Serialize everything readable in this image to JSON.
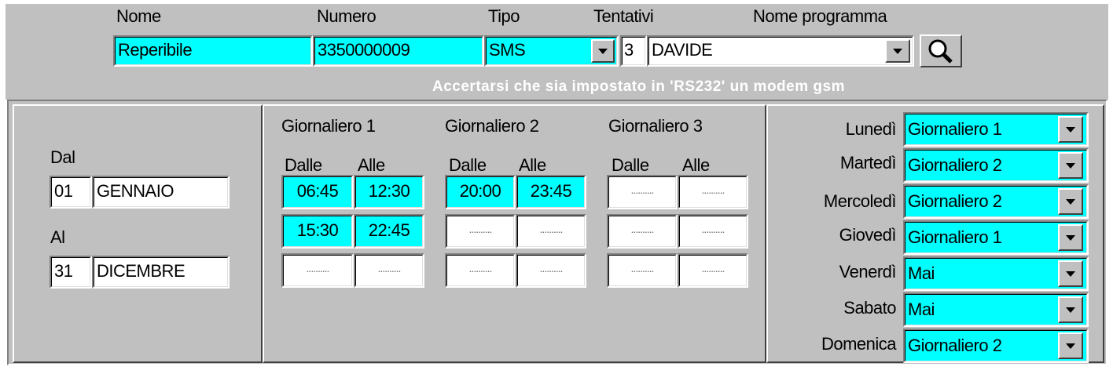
{
  "header": {
    "labels": {
      "nome": "Nome",
      "numero": "Numero",
      "tipo": "Tipo",
      "tentativi": "Tentativi",
      "nome_programma": "Nome programma"
    },
    "values": {
      "nome": "Reperibile",
      "numero": "3350000009",
      "tipo": "SMS",
      "tentativi": "3",
      "nome_programma": "DAVIDE"
    },
    "note": "Accertarsi che sia impostato in 'RS232' un modem gsm",
    "search_icon": "magnifier-icon"
  },
  "period": {
    "dal_label": "Dal",
    "dal_day": "01",
    "dal_month": "GENNAIO",
    "al_label": "Al",
    "al_day": "31",
    "al_month": "DICEMBRE"
  },
  "schedules": {
    "dalle_label": "Dalle",
    "alle_label": "Alle",
    "empty": "..........",
    "groups": [
      {
        "title": "Giornaliero 1",
        "rows": [
          [
            "06:45",
            "12:30"
          ],
          [
            "15:30",
            "22:45"
          ],
          [
            "",
            ""
          ]
        ]
      },
      {
        "title": "Giornaliero 2",
        "rows": [
          [
            "20:00",
            "23:45"
          ],
          [
            "",
            ""
          ],
          [
            "",
            ""
          ]
        ]
      },
      {
        "title": "Giornaliero 3",
        "rows": [
          [
            "",
            ""
          ],
          [
            "",
            ""
          ],
          [
            "",
            ""
          ]
        ]
      }
    ]
  },
  "days": [
    {
      "label": "Lunedì",
      "value": "Giornaliero 1"
    },
    {
      "label": "Martedì",
      "value": "Giornaliero 2"
    },
    {
      "label": "Mercoledì",
      "value": "Giornaliero 2"
    },
    {
      "label": "Giovedì",
      "value": "Giornaliero 1"
    },
    {
      "label": "Venerdì",
      "value": "Mai"
    },
    {
      "label": "Sabato",
      "value": "Mai"
    },
    {
      "label": "Domenica",
      "value": "Giornaliero 2"
    }
  ],
  "colors": {
    "highlight": "#00ffff",
    "panel": "#c0c0c0"
  }
}
